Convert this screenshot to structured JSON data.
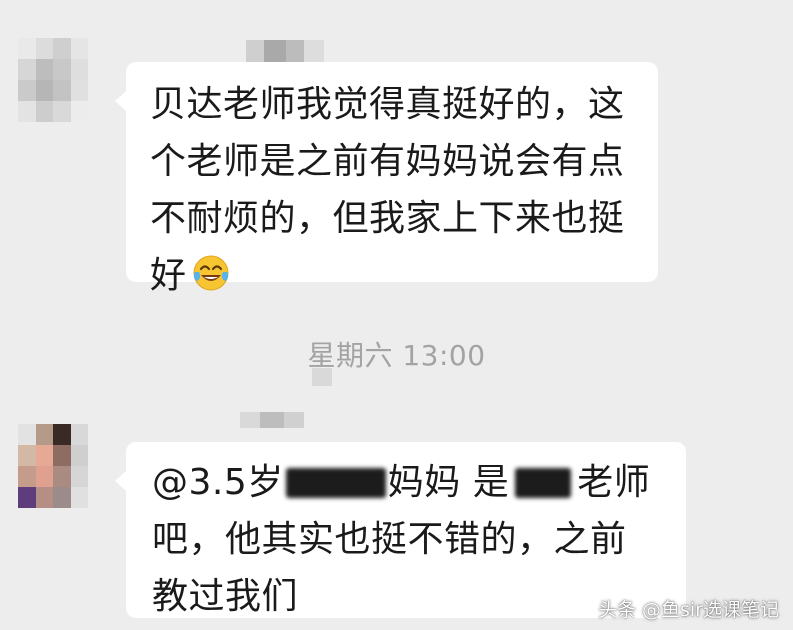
{
  "messages": [
    {
      "lines": [
        "贝达老师我觉得真挺好的，这",
        "个老师是之前有妈妈说会有点",
        "不耐烦的，但我家上下来也挺",
        "好"
      ],
      "emoji": "tears-of-joy-emoji"
    },
    {
      "line1_a": "@3.5岁",
      "line1_b": "妈妈 是",
      "line1_c": "老师",
      "line2": "吧，他其实也挺不错的，之前",
      "line3": "教过我们"
    }
  ],
  "timestamp": "星期六 13:00",
  "watermark": "头条 @鱼sir选课笔记",
  "colors": {
    "background": "#ededed",
    "bubble": "#ffffff",
    "text": "#1a1a1a",
    "timestamp": "#a3a3a3"
  }
}
